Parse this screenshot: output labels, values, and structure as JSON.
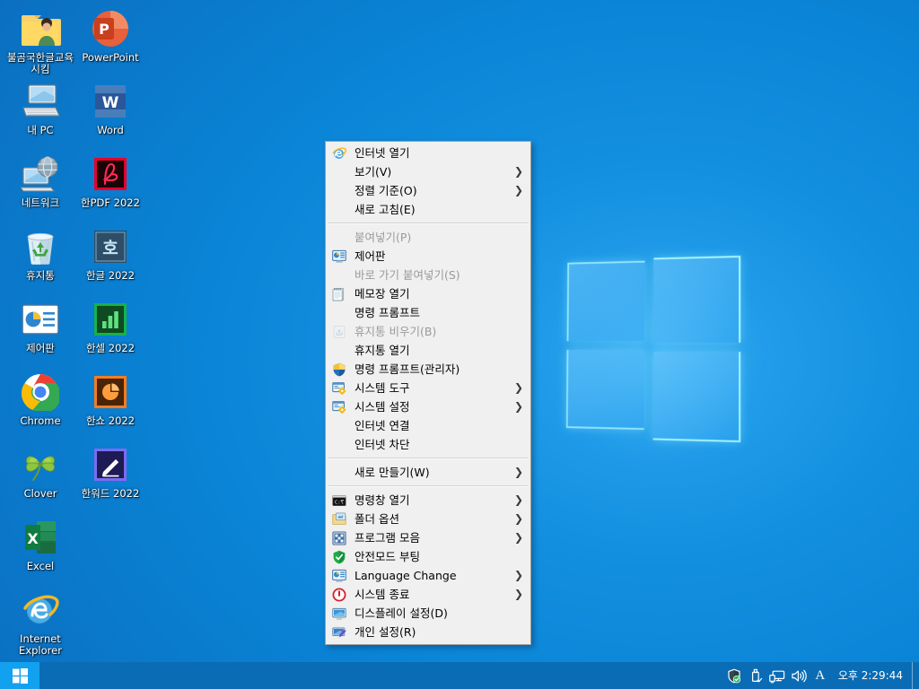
{
  "desktop": {
    "background_color": "#0a8ada",
    "wallpaper": "windows-10-hero-logo"
  },
  "icons": [
    {
      "label": "불곰국한글교육시킴",
      "art": "folder-user",
      "col": 0,
      "row": 0
    },
    {
      "label": "PowerPoint",
      "art": "powerpoint",
      "col": 1,
      "row": 0
    },
    {
      "label": "내 PC",
      "art": "this-pc",
      "col": 0,
      "row": 1
    },
    {
      "label": "Word",
      "art": "word",
      "col": 1,
      "row": 1
    },
    {
      "label": "네트워크",
      "art": "network",
      "col": 0,
      "row": 2
    },
    {
      "label": "한PDF 2022",
      "art": "hanpdf",
      "col": 1,
      "row": 2
    },
    {
      "label": "휴지통",
      "art": "recycle-bin",
      "col": 0,
      "row": 3
    },
    {
      "label": "한글 2022",
      "art": "hangul",
      "col": 1,
      "row": 3
    },
    {
      "label": "제어판",
      "art": "control-panel",
      "col": 0,
      "row": 4
    },
    {
      "label": "한셀 2022",
      "art": "hancell",
      "col": 1,
      "row": 4
    },
    {
      "label": "Chrome",
      "art": "chrome",
      "col": 0,
      "row": 5
    },
    {
      "label": "한쇼 2022",
      "art": "hanshow",
      "col": 1,
      "row": 5
    },
    {
      "label": "Clover",
      "art": "clover",
      "col": 0,
      "row": 6
    },
    {
      "label": "한워드 2022",
      "art": "hanword",
      "col": 1,
      "row": 6
    },
    {
      "label": "Excel",
      "art": "excel",
      "col": 0,
      "row": 7
    },
    {
      "label": "Internet Explorer",
      "art": "internet-explorer",
      "col": 0,
      "row": 8
    }
  ],
  "context_menu": {
    "items": [
      {
        "type": "item",
        "label": "인터넷 열기",
        "icon": "internet-explorer-icon",
        "arrow": false,
        "disabled": false
      },
      {
        "type": "item",
        "label": "보기(V)",
        "icon": "none",
        "arrow": true,
        "disabled": false
      },
      {
        "type": "item",
        "label": "정렬 기준(O)",
        "icon": "none",
        "arrow": true,
        "disabled": false
      },
      {
        "type": "item",
        "label": "새로 고침(E)",
        "icon": "none",
        "arrow": false,
        "disabled": false
      },
      {
        "type": "separator"
      },
      {
        "type": "item",
        "label": "붙여넣기(P)",
        "icon": "none",
        "arrow": false,
        "disabled": true
      },
      {
        "type": "item",
        "label": "제어판",
        "icon": "control-panel-icon",
        "arrow": false,
        "disabled": false
      },
      {
        "type": "item",
        "label": "바로 가기 붙여넣기(S)",
        "icon": "none",
        "arrow": false,
        "disabled": true
      },
      {
        "type": "item",
        "label": "메모장 열기",
        "icon": "notepad-icon",
        "arrow": false,
        "disabled": false
      },
      {
        "type": "item",
        "label": "명령 프롬프트",
        "icon": "none",
        "arrow": false,
        "disabled": false
      },
      {
        "type": "item",
        "label": "휴지통 비우기(B)",
        "icon": "recycle-bin-icon",
        "arrow": false,
        "disabled": true
      },
      {
        "type": "item",
        "label": "휴지통 열기",
        "icon": "none",
        "arrow": false,
        "disabled": false
      },
      {
        "type": "item",
        "label": "명령 프롬프트(관리자)",
        "icon": "uac-shield-icon",
        "arrow": false,
        "disabled": false
      },
      {
        "type": "item",
        "label": "시스템 도구",
        "icon": "system-tools-icon",
        "arrow": true,
        "disabled": false
      },
      {
        "type": "item",
        "label": "시스템 설정",
        "icon": "system-tools-icon",
        "arrow": true,
        "disabled": false
      },
      {
        "type": "item",
        "label": "인터넷 연결",
        "icon": "none",
        "arrow": false,
        "disabled": false
      },
      {
        "type": "item",
        "label": "인터넷 차단",
        "icon": "none",
        "arrow": false,
        "disabled": false
      },
      {
        "type": "separator"
      },
      {
        "type": "item",
        "label": "새로 만들기(W)",
        "icon": "none",
        "arrow": true,
        "disabled": false
      },
      {
        "type": "separator"
      },
      {
        "type": "item",
        "label": "명령창 열기",
        "icon": "cmd-icon",
        "arrow": true,
        "disabled": false
      },
      {
        "type": "item",
        "label": "폴더 옵션",
        "icon": "folder-options-icon",
        "arrow": true,
        "disabled": false
      },
      {
        "type": "item",
        "label": "프로그램 모음",
        "icon": "programs-icon",
        "arrow": true,
        "disabled": false
      },
      {
        "type": "item",
        "label": "안전모드 부팅",
        "icon": "green-shield-icon",
        "arrow": false,
        "disabled": false
      },
      {
        "type": "item",
        "label": "Language Change",
        "icon": "control-panel-icon",
        "arrow": true,
        "disabled": false
      },
      {
        "type": "item",
        "label": "시스템 종료",
        "icon": "power-icon",
        "arrow": true,
        "disabled": false
      },
      {
        "type": "item",
        "label": "디스플레이 설정(D)",
        "icon": "display-icon",
        "arrow": false,
        "disabled": false
      },
      {
        "type": "item",
        "label": "개인 설정(R)",
        "icon": "personalize-icon",
        "arrow": false,
        "disabled": false
      }
    ],
    "submenu_arrow_glyph": "❯"
  },
  "taskbar": {
    "background_color": "#0a6cb4",
    "start_button": {
      "name": "start",
      "highlight_color": "#12a1ef"
    },
    "tray_icons": [
      {
        "name": "defender-shield-icon",
        "title": "Windows 보안"
      },
      {
        "name": "usb-eject-icon",
        "title": "하드웨어 안전하게 제거"
      },
      {
        "name": "network-icon",
        "title": "네트워크"
      },
      {
        "name": "volume-icon",
        "title": "볼륨"
      },
      {
        "name": "ime-icon",
        "title": "A",
        "glyph": "A"
      }
    ],
    "clock": "오후 2:29:44"
  }
}
